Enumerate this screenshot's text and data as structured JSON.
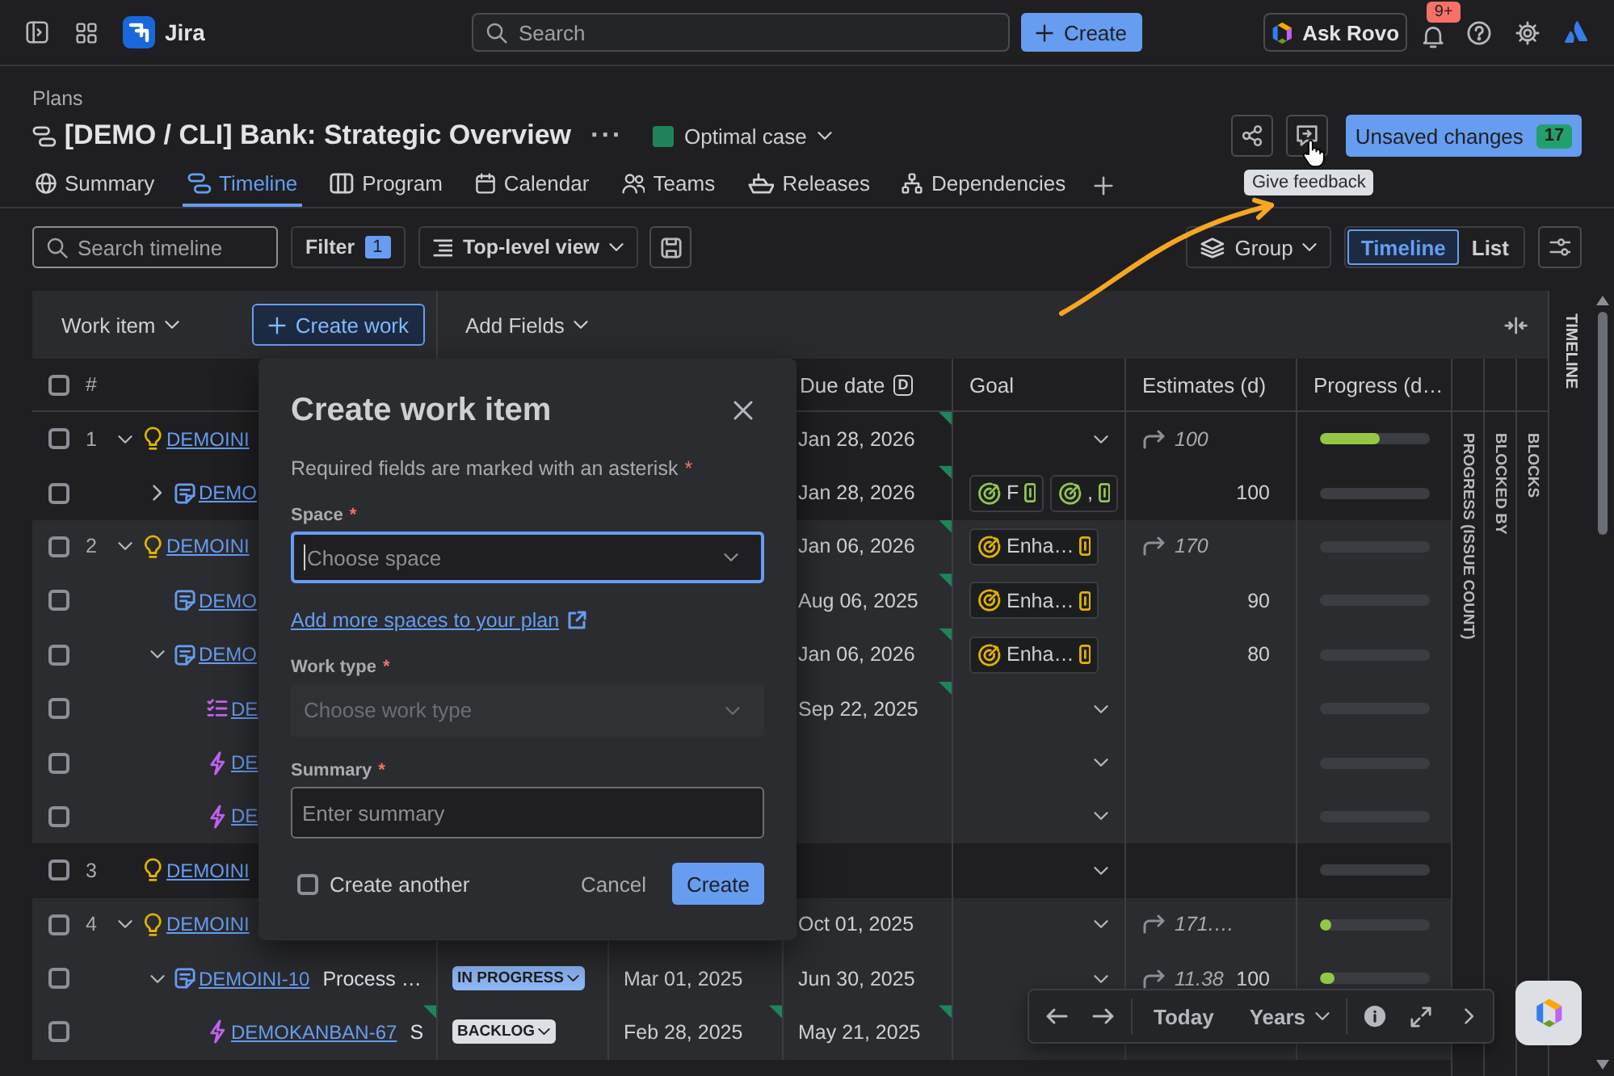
{
  "topbar": {
    "app_name": "Jira",
    "search": {
      "placeholder": "Search"
    },
    "create_button": "Create",
    "ask_button": "Ask Rovo",
    "notifications_badge": "9+"
  },
  "header": {
    "breadcrumb": "Plans",
    "title": "[DEMO / CLI] Bank: Strategic Overview",
    "more_menu": "···",
    "scenario": {
      "label": "Optimal case",
      "color": "#1f845a"
    },
    "unsaved_changes": {
      "label": "Unsaved changes",
      "count": "17"
    },
    "tooltip": "Give feedback"
  },
  "tabs": [
    {
      "label": "Summary",
      "selected": false
    },
    {
      "label": "Timeline",
      "selected": true
    },
    {
      "label": "Program",
      "selected": false
    },
    {
      "label": "Calendar",
      "selected": false
    },
    {
      "label": "Teams",
      "selected": false
    },
    {
      "label": "Releases",
      "selected": false
    },
    {
      "label": "Dependencies",
      "selected": false
    }
  ],
  "toolbar": {
    "search": {
      "placeholder": "Search timeline"
    },
    "filter": {
      "label": "Filter",
      "count": "1"
    },
    "view_menu": "Top-level view",
    "group_menu": "Group",
    "view_toggle": [
      {
        "label": "Timeline",
        "selected": true
      },
      {
        "label": "List",
        "selected": false
      }
    ]
  },
  "table": {
    "work_item_menu": "Work item",
    "create_work": "Create work",
    "add_fields": "Add Fields",
    "select_all_checked": false,
    "number_header": "#",
    "columns": [
      {
        "label": "Due date",
        "badge": "D"
      },
      {
        "label": "Goal"
      },
      {
        "label": "Estimates (d)"
      },
      {
        "label": "Progress (d…"
      }
    ],
    "side_columns": [
      "PROGRESS (ISSUE COUNT)",
      "BLOCKED BY",
      "BLOCKS"
    ],
    "rows": [
      {
        "number": "1",
        "kind": "initiative",
        "key": "DEMOINI",
        "expanded": true,
        "checked": false,
        "due": "Jan 28, 2026",
        "due_changed": true,
        "goal_dropdown": true,
        "estimate": {
          "rollup": "100"
        },
        "level": 0.54,
        "children": [
          {
            "kind": "feature",
            "key": "DEMO",
            "expanded": false,
            "checked": false,
            "due": "Jan 28, 2026",
            "due_changed": true,
            "goals": [
              {
                "label": "F",
                "color": "#94c748"
              },
              {
                "label": ",",
                "color": "#94c748"
              }
            ],
            "estimate": {
              "value": "100"
            },
            "level": 0
          }
        ]
      },
      {
        "number": "2",
        "kind": "initiative",
        "key": "DEMOINI",
        "expanded": true,
        "checked": false,
        "due": "Jan 06, 2026",
        "due_changed": true,
        "goals": [
          {
            "label": "Enha…",
            "color": "#e2b203"
          }
        ],
        "estimate": {
          "rollup": "170"
        },
        "level": 0,
        "children": [
          {
            "kind": "feature",
            "key": "DEMO",
            "checked": false,
            "due": "Aug 06, 2025",
            "due_changed": true,
            "goals": [
              {
                "label": "Enha…",
                "color": "#e2b203"
              }
            ],
            "estimate": {
              "value": "90"
            },
            "level": 0
          },
          {
            "kind": "feature",
            "key": "DEMO",
            "expanded": true,
            "checked": false,
            "due": "Jan 06, 2026",
            "due_changed": true,
            "goals": [
              {
                "label": "Enha…",
                "color": "#e2b203"
              }
            ],
            "estimate": {
              "value": "80"
            },
            "level": 0,
            "children": [
              {
                "kind": "checklist",
                "key": "DE",
                "checked": false,
                "due": "Sep 22, 2025",
                "due_changed": true,
                "goal_dropdown": true,
                "level": 0
              },
              {
                "kind": "epic",
                "key": "DE",
                "checked": false,
                "due_changed": false,
                "goal_dropdown": true,
                "level": 0
              },
              {
                "kind": "epic",
                "key": "DE",
                "checked": false,
                "due_changed": false,
                "goal_dropdown": true,
                "level": 0
              }
            ]
          }
        ]
      },
      {
        "number": "3",
        "kind": "initiative",
        "key": "DEMOINI",
        "checked": false,
        "due_changed": false,
        "goal_dropdown": true,
        "level": 0
      },
      {
        "number": "4",
        "kind": "initiative",
        "key": "DEMOINI",
        "expanded": true,
        "checked": false,
        "due": "Oct 01, 2025",
        "due_changed": false,
        "goal_dropdown": true,
        "estimate": {
          "rollup": "171.…"
        },
        "level": 0.1,
        "children": [
          {
            "kind": "feature",
            "key": "DEMOINI-10",
            "summary": "Process …",
            "summary_changed": false,
            "status": {
              "label": "IN PROGRESS",
              "color": "#8fb8f6"
            },
            "start": "Mar 01, 2025",
            "start_changed": false,
            "expanded": true,
            "checked": false,
            "due": "Jun 30, 2025",
            "due_changed": false,
            "goal_dropdown": true,
            "estimate": {
              "rollup": "11.38",
              "value": "100"
            },
            "level": 0.13,
            "children": [
              {
                "kind": "epic",
                "key": "DEMOKANBAN-67",
                "summary": "S",
                "summary_changed": true,
                "status": {
                  "label": "BACKLOG",
                  "color": "#dcdfe4"
                },
                "start": "Feb 28, 2025",
                "start_changed": true,
                "checked": false,
                "due": "May 21, 2025",
                "due_changed": true
              }
            ]
          }
        ]
      }
    ]
  },
  "timeline_panel": {
    "label": "TIMELINE"
  },
  "dialog": {
    "title": "Create work item",
    "note": "Required fields are marked with an asterisk",
    "required_mark": "*",
    "fields": [
      {
        "kind": "select",
        "label": "Space",
        "required": true,
        "placeholder": "Choose space",
        "focused": true,
        "disabled": false,
        "help_link": "Add more spaces to your plan"
      },
      {
        "kind": "select",
        "label": "Work type",
        "required": true,
        "placeholder": "Choose work type",
        "focused": false,
        "disabled": true
      },
      {
        "kind": "text",
        "label": "Summary",
        "required": true,
        "placeholder": "Enter summary",
        "focused": false,
        "disabled": false
      }
    ],
    "create_another": {
      "label": "Create another",
      "checked": false
    },
    "buttons": [
      {
        "label": "Cancel",
        "kind": "subtle"
      },
      {
        "label": "Create",
        "kind": "primary"
      }
    ]
  },
  "timeline_controls": {
    "today": "Today",
    "scale": "Years"
  }
}
